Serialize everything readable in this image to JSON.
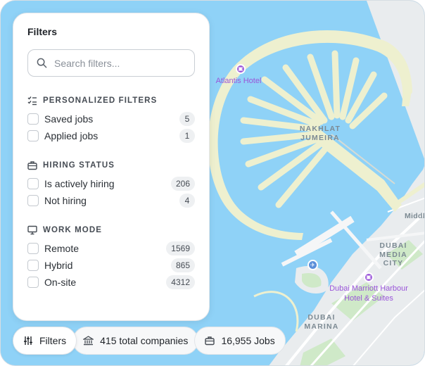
{
  "panel": {
    "title": "Filters",
    "search_placeholder": "Search filters..."
  },
  "sections": [
    {
      "icon": "checklist-icon",
      "title": "PERSONALIZED FILTERS",
      "items": [
        {
          "label": "Saved jobs",
          "count": "5"
        },
        {
          "label": "Applied jobs",
          "count": "1"
        }
      ]
    },
    {
      "icon": "briefcase-icon",
      "title": "HIRING STATUS",
      "items": [
        {
          "label": "Is actively hiring",
          "count": "206"
        },
        {
          "label": "Not hiring",
          "count": "4"
        }
      ]
    },
    {
      "icon": "monitor-icon",
      "title": "WORK MODE",
      "items": [
        {
          "label": "Remote",
          "count": "1569"
        },
        {
          "label": "Hybrid",
          "count": "865"
        },
        {
          "label": "On-site",
          "count": "4312"
        }
      ]
    }
  ],
  "bottom_bar": {
    "filters_label": "Filters",
    "companies_label": "415 total companies",
    "jobs_label": "16,955 Jobs"
  },
  "map": {
    "labels": {
      "atlantis": "Atlantis Hotel",
      "nakhlat_1": "NAKHLAT",
      "nakhlat_2": "JUMEIRA",
      "media_1": "DUBAI",
      "media_2": "MEDIA CITY",
      "marriott_1": "Dubai Marriott Harbour",
      "marriott_2": "Hotel & Suites",
      "marina_1": "DUBAI",
      "marina_2": "MARINA",
      "middle": "Middl"
    },
    "colors": {
      "water": "#8fd2f7",
      "sand": "#eef0cf",
      "land": "#e9ecee",
      "green": "#cfe9c8",
      "poi": "#9a55d9"
    }
  }
}
